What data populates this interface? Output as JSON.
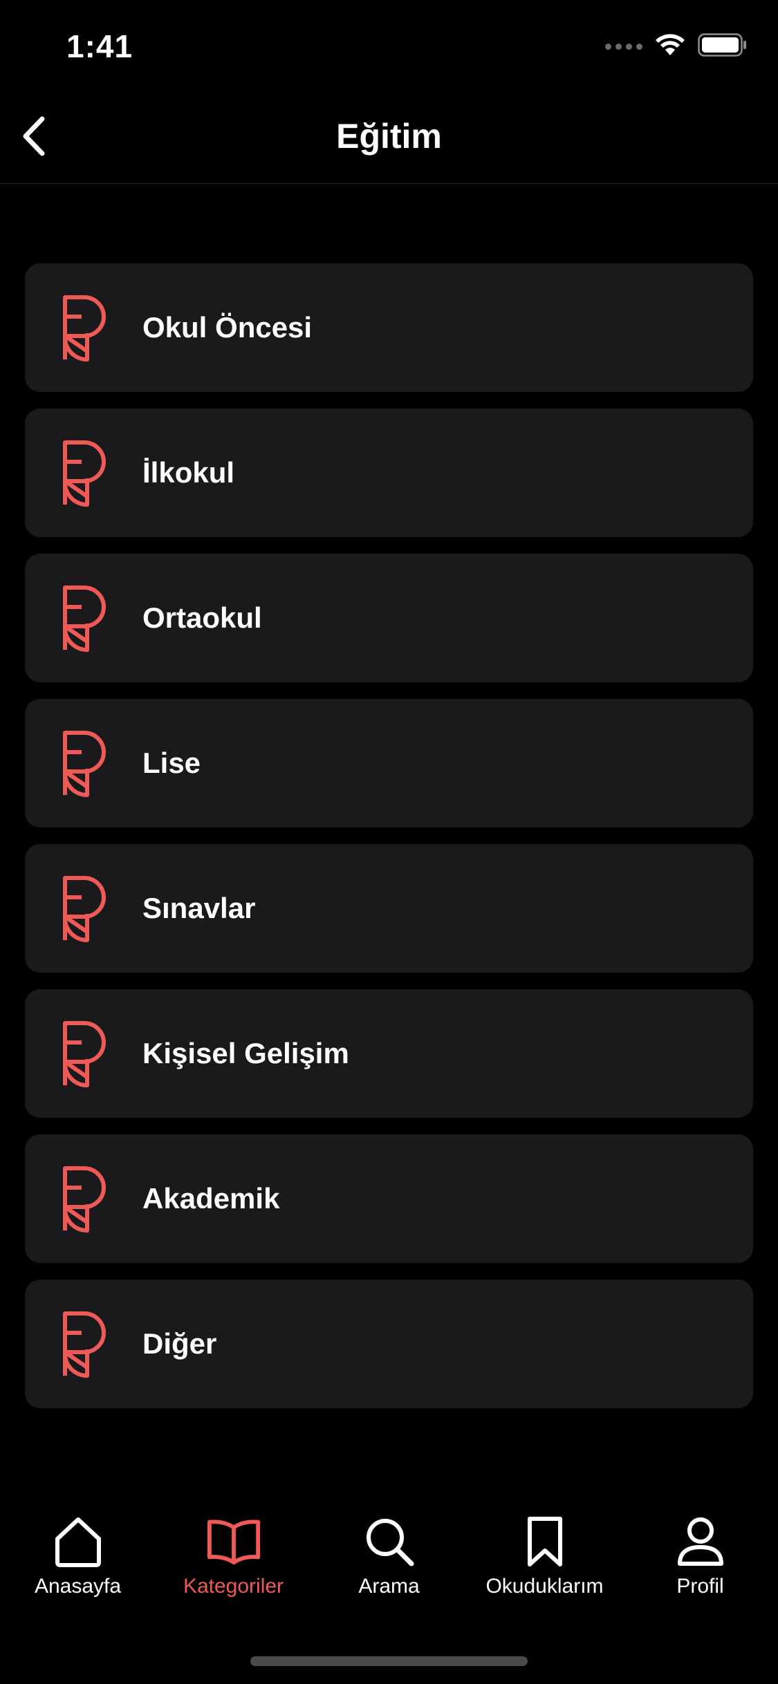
{
  "status_bar": {
    "time": "1:41"
  },
  "nav": {
    "title": "Eğitim",
    "back_icon": "chevron-left-icon"
  },
  "categories": [
    {
      "label": "Okul Öncesi",
      "icon": "book-logo-icon"
    },
    {
      "label": "İlkokul",
      "icon": "book-logo-icon"
    },
    {
      "label": "Ortaokul",
      "icon": "book-logo-icon"
    },
    {
      "label": "Lise",
      "icon": "book-logo-icon"
    },
    {
      "label": "Sınavlar",
      "icon": "book-logo-icon"
    },
    {
      "label": "Kişisel Gelişim",
      "icon": "book-logo-icon"
    },
    {
      "label": "Akademik",
      "icon": "book-logo-icon"
    },
    {
      "label": "Diğer",
      "icon": "book-logo-icon"
    }
  ],
  "tabs": [
    {
      "label": "Anasayfa",
      "icon": "home-icon",
      "active": false
    },
    {
      "label": "Kategoriler",
      "icon": "open-book-icon",
      "active": true
    },
    {
      "label": "Arama",
      "icon": "search-icon",
      "active": false
    },
    {
      "label": "Okuduklarım",
      "icon": "bookmark-icon",
      "active": false
    },
    {
      "label": "Profil",
      "icon": "user-icon",
      "active": false
    }
  ],
  "colors": {
    "background": "#000000",
    "card": "#1a1a1c",
    "accent": "#ef5a57",
    "text": "#ffffff"
  }
}
